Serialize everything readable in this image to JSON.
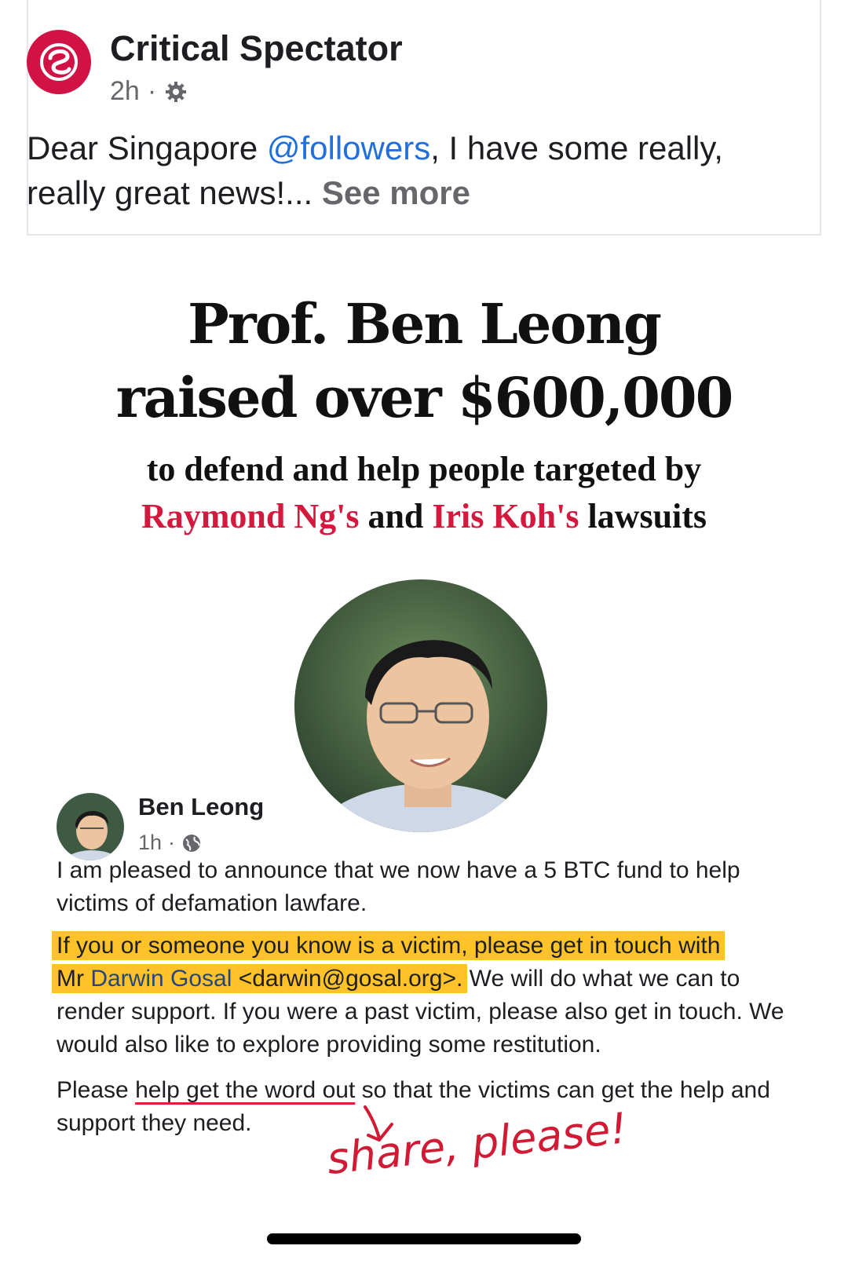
{
  "post": {
    "page_name": "Critical Spectator",
    "time": "2h",
    "separator": "·",
    "text_before": "Dear Singapore ",
    "mention": "@followers",
    "text_after": ", I have some really, really great news!... ",
    "see_more": "See more",
    "privacy_icon": "gear-icon",
    "brand_color": "#d11244"
  },
  "image": {
    "headline_line1": "Prof. Ben Leong",
    "headline_line2": "raised over $600,000",
    "sub_line1": "to defend and help people targeted by",
    "sub_name1": "Raymond Ng's",
    "sub_and": " and ",
    "sub_name2": "Iris Koh's",
    "sub_end": " lawsuits",
    "accent_color": "#d4193f"
  },
  "embedded_post": {
    "author": "Ben Leong",
    "time": "1h",
    "separator": "·",
    "privacy_icon": "globe-icon",
    "para1": "I am pleased to announce that we now have a 5 BTC fund to help victims of defamation lawfare.",
    "para2_hl1": "If you or someone you know is a victim, please get in touch with",
    "para2_hl2_pre": "Mr ",
    "para2_hl2_name": "Darwin Gosal",
    "para2_hl2_email": " <darwin@gosal.org>.",
    "para2_rest": " We will do what we can to render support. If you were a past victim, please also get in touch. We would also like to explore providing some restitution.",
    "para3_pre": "Please ",
    "para3_underlined": "help get the word out",
    "para3_post": " so that the victims can get the help and support they need.",
    "highlight_color": "#ffc229"
  },
  "annotation": {
    "handwritten": "share, please!",
    "color": "#d11a33"
  }
}
